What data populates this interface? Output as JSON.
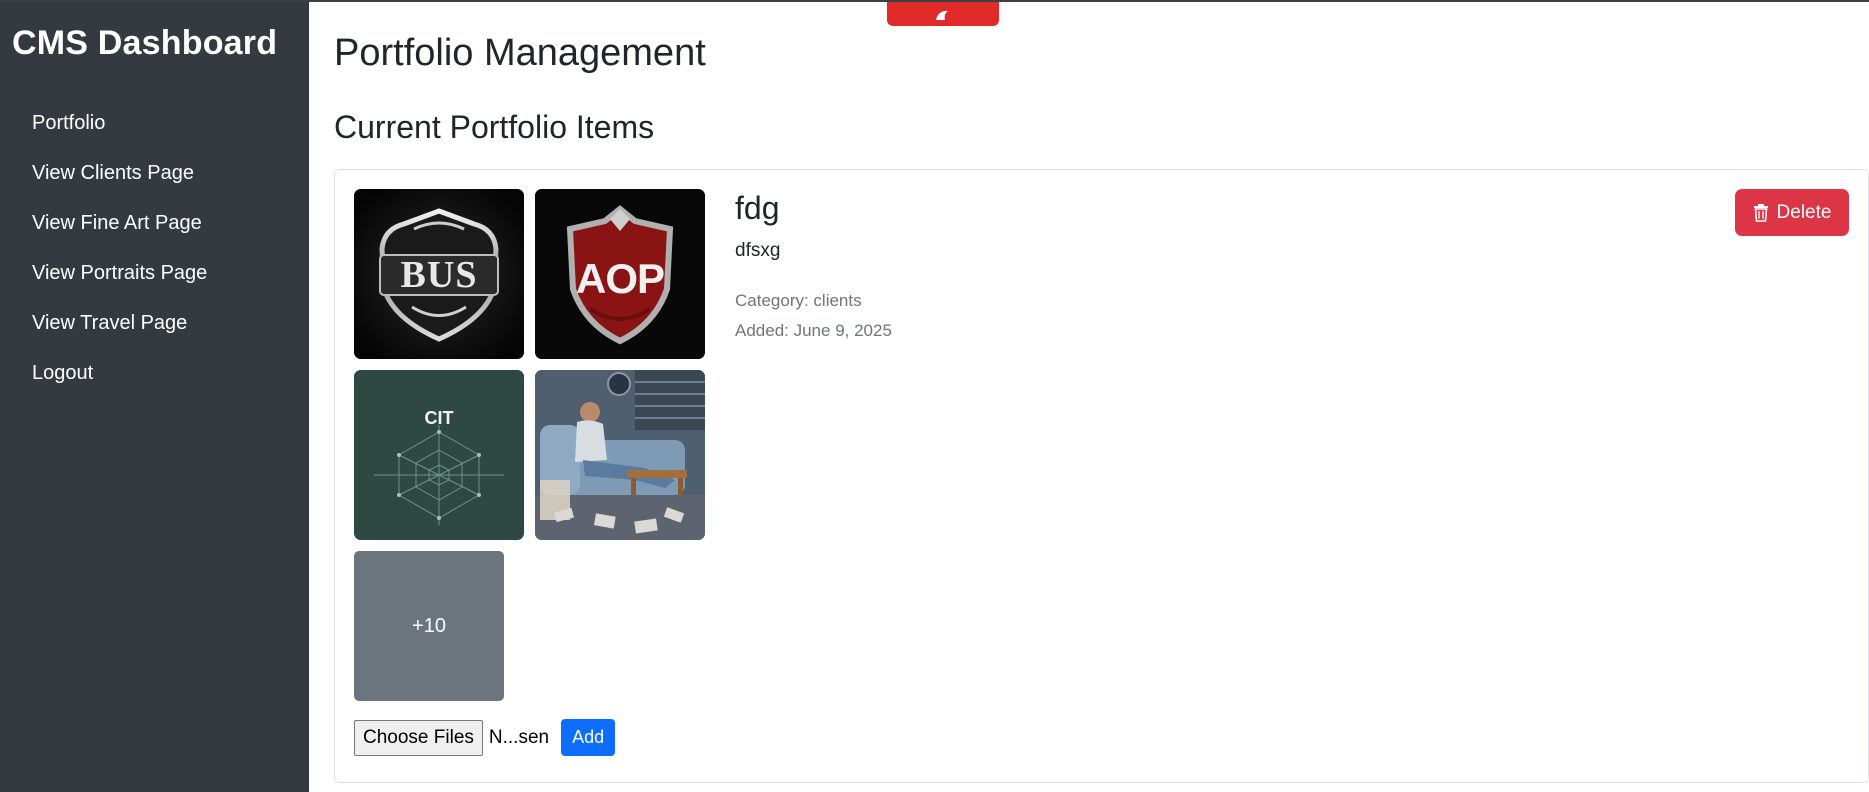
{
  "sidebar": {
    "title": "CMS Dashboard",
    "items": [
      {
        "label": "Portfolio"
      },
      {
        "label": "View Clients Page"
      },
      {
        "label": "View Fine Art Page"
      },
      {
        "label": "View Portraits Page"
      },
      {
        "label": "View Travel Page"
      },
      {
        "label": "Logout"
      }
    ]
  },
  "main": {
    "page_title": "Portfolio Management",
    "section_title": "Current Portfolio Items"
  },
  "item": {
    "title": "fdg",
    "description": "dfsxg",
    "category": "Category: clients",
    "added": "Added: June 9, 2025",
    "delete_label": "Delete",
    "delete_icon": "trash-icon",
    "images": [
      {
        "label": "BUS",
        "kind": "bus-logo"
      },
      {
        "label": "AOP",
        "kind": "aop-logo"
      },
      {
        "label": "CIT",
        "kind": "cit-logo"
      },
      {
        "kind": "person-on-couch-photo"
      }
    ],
    "more_count": "+10",
    "choose_files_label": "Choose Files",
    "file_status": "N...sen",
    "add_label": "Add"
  },
  "colors": {
    "sidebar_bg": "#343a40",
    "danger": "#dc3545",
    "primary": "#0d6efd",
    "secondary": "#6c757d",
    "top_tab": "#e02a2a"
  }
}
